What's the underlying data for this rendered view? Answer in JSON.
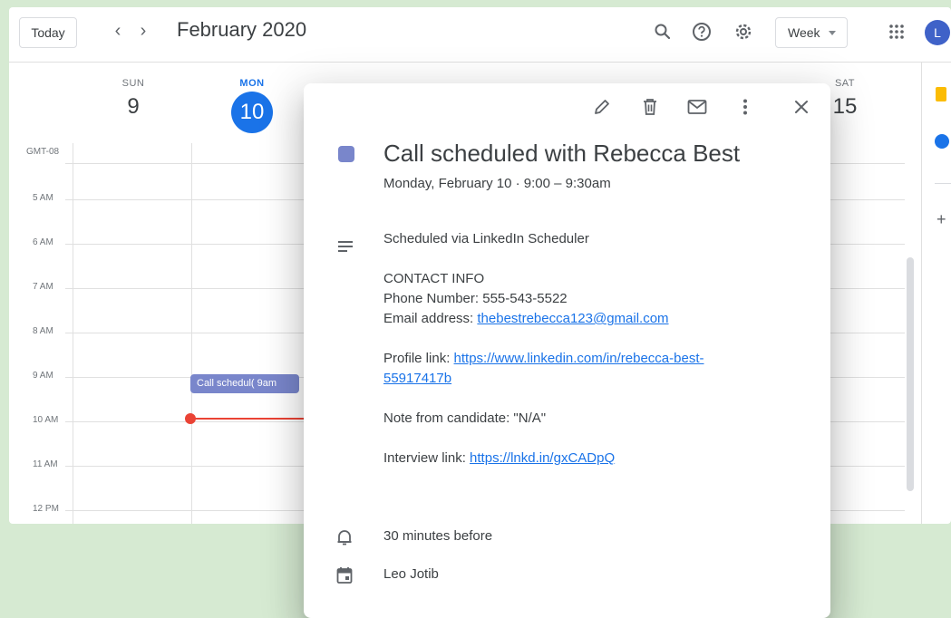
{
  "header": {
    "today_label": "Today",
    "prev_label": "‹",
    "next_label": "›",
    "month_title": "February 2020",
    "view_label": "Week",
    "avatar_letter": "L"
  },
  "timezone": "GMT-08",
  "days": [
    {
      "name": "SUN",
      "num": "9"
    },
    {
      "name": "MON",
      "num": "10"
    },
    {
      "name": "SAT",
      "num": "15"
    }
  ],
  "hours": [
    "5 AM",
    "6 AM",
    "7 AM",
    "8 AM",
    "9 AM",
    "10 AM",
    "11 AM",
    "12 PM"
  ],
  "calendar_event_chip": "Call schedul( 9am",
  "popover": {
    "title": "Call scheduled with Rebecca Best",
    "when": "Monday, February 10  ·  9:00 – 9:30am",
    "desc_line1": "Scheduled via LinkedIn Scheduler",
    "contact_header": "CONTACT INFO",
    "phone": "Phone Number: 555-543-5522",
    "email_prefix": "Email address: ",
    "email_link": "thebestrebecca123@gmail.com",
    "profile_prefix": "Profile link: ",
    "profile_link_a": "https://www.linkedin.com/in/rebecca-best-",
    "profile_link_b": "55917417b",
    "note": "Note from candidate: \"N/A\"",
    "interview_prefix": "Interview link: ",
    "interview_link": "https://lnkd.in/gxCADpQ",
    "reminder": "30 minutes before",
    "organizer": "Leo Jotib"
  },
  "colors": {
    "accent": "#1a73e8",
    "event": "#7986cb",
    "now_line": "#ea4335",
    "background": "#d6ead2"
  }
}
